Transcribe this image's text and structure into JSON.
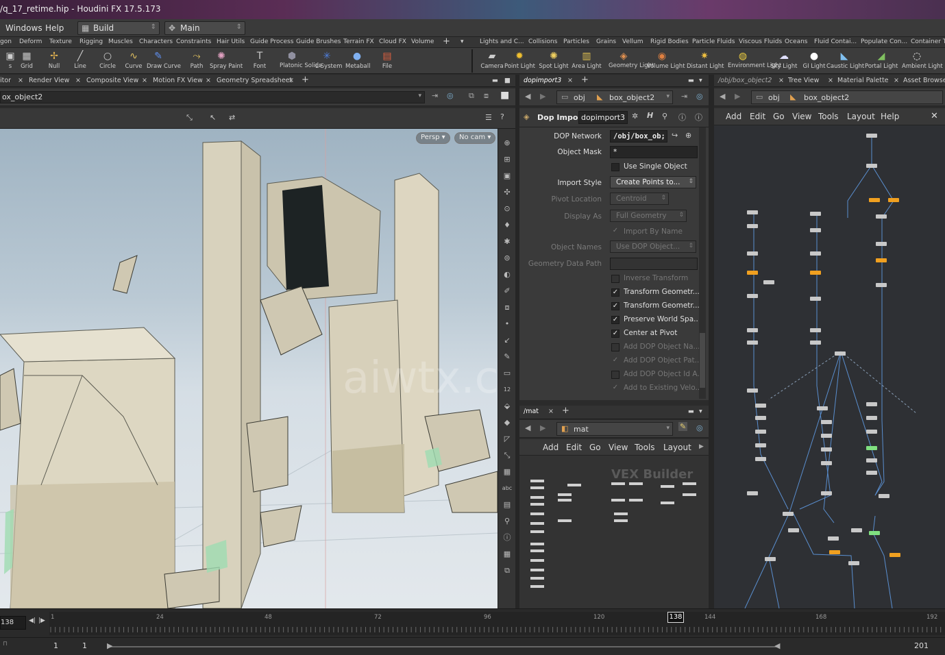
{
  "window": {
    "title": "/q_17_retime.hip - Houdini FX 17.5.173"
  },
  "menubar": {
    "windows": "Windows",
    "help": "Help",
    "desktop": "Build",
    "desktop_icon": "grid-icon",
    "shelfset": "Main"
  },
  "shelf_tabs_left": [
    "gon",
    "Deform",
    "Texture",
    "Rigging",
    "Muscles",
    "Characters",
    "Constraints",
    "Hair Utils",
    "Guide Process",
    "Guide Brushes",
    "Terrain FX",
    "Cloud FX",
    "Volume"
  ],
  "shelf_tabs_right": [
    "Lights and C...",
    "Collisions",
    "Particles",
    "Grains",
    "Vellum",
    "Rigid Bodies",
    "Particle Fluids",
    "Viscous Fluids",
    "Oceans",
    "Fluid Contai...",
    "Populate Con...",
    "Container To"
  ],
  "tools_left": [
    {
      "label": "s",
      "icon": "box-icon"
    },
    {
      "label": "Grid",
      "icon": "grid-icon"
    },
    {
      "label": "Null",
      "icon": "null-icon"
    },
    {
      "label": "Line",
      "icon": "line-icon"
    },
    {
      "label": "Circle",
      "icon": "circle-icon"
    },
    {
      "label": "Curve",
      "icon": "curve-icon"
    },
    {
      "label": "Draw Curve",
      "icon": "pen-icon"
    },
    {
      "label": "Path",
      "icon": "path-icon"
    },
    {
      "label": "Spray Paint",
      "icon": "spray-icon"
    },
    {
      "label": "Font",
      "icon": "font-icon"
    },
    {
      "label": "Platonic Solids",
      "icon": "platonic-icon"
    },
    {
      "label": "L-System",
      "icon": "lsystem-icon"
    },
    {
      "label": "Metaball",
      "icon": "metaball-icon"
    },
    {
      "label": "File",
      "icon": "file-icon"
    }
  ],
  "tools_right": [
    {
      "label": "Camera",
      "icon": "camera-icon"
    },
    {
      "label": "Point Light",
      "icon": "point-light-icon"
    },
    {
      "label": "Spot Light",
      "icon": "spot-light-icon"
    },
    {
      "label": "Area Light",
      "icon": "area-light-icon"
    },
    {
      "label": "Geometry Light",
      "icon": "geometry-light-icon"
    },
    {
      "label": "Volume Light",
      "icon": "volume-light-icon"
    },
    {
      "label": "Distant Light",
      "icon": "distant-light-icon"
    },
    {
      "label": "Environment Light",
      "icon": "environment-light-icon"
    },
    {
      "label": "Sky Light",
      "icon": "sky-light-icon"
    },
    {
      "label": "GI Light",
      "icon": "gi-light-icon"
    },
    {
      "label": "Caustic Light",
      "icon": "caustic-light-icon"
    },
    {
      "label": "Portal Light",
      "icon": "portal-light-icon"
    },
    {
      "label": "Ambient Light",
      "icon": "ambient-light-icon"
    }
  ],
  "viewer_tabs": [
    "itor",
    "Render View",
    "Composite View",
    "Motion FX View",
    "Geometry Spreadsheet"
  ],
  "viewer_path": "ox_object2",
  "viewport": {
    "persp": "Persp",
    "cam": "No cam",
    "watermark": "aiwtx.com"
  },
  "param_tabs": [
    "dopimport3"
  ],
  "param_path": {
    "root": "obj",
    "node": "box_object2"
  },
  "node": {
    "type": "Dop Import",
    "name": "dopimport3"
  },
  "params": {
    "dop_network": {
      "label": "DOP Network",
      "value": "/obj/box_ob;"
    },
    "object_mask": {
      "label": "Object Mask",
      "value": "*"
    },
    "use_single": "Use Single Object",
    "import_style": {
      "label": "Import Style",
      "value": "Create Points to..."
    },
    "pivot_location": {
      "label": "Pivot Location",
      "value": "Centroid"
    },
    "display_as": {
      "label": "Display As",
      "value": "Full Geometry"
    },
    "import_by_name": "Import By Name",
    "object_names": {
      "label": "Object Names",
      "value": "Use DOP Object..."
    },
    "geo_data_path": {
      "label": "Geometry Data Path",
      "value": ""
    },
    "inverse": "Inverse Transform",
    "xform1": "Transform Geometr...",
    "xform2": "Transform Geometr...",
    "preserve": "Preserve World Spa...",
    "center": "Center at Pivot",
    "add_name": "Add DOP Object Na...",
    "add_path": "Add DOP Object Pat...",
    "add_id": "Add DOP Object Id A...",
    "add_vel": "Add to Existing Velo..."
  },
  "mat_tabs": [
    "/mat"
  ],
  "mat_path": "mat",
  "mat_menu": [
    "Add",
    "Edit",
    "Go",
    "View",
    "Tools",
    "Layout"
  ],
  "mat_watermark": "VEX Builder",
  "net_tabs": [
    "/obj/box_object2",
    "Tree View",
    "Material Palette",
    "Asset Browser"
  ],
  "net_path": {
    "root": "obj",
    "node": "box_object2"
  },
  "net_menu": [
    "Add",
    "Edit",
    "Go",
    "View",
    "Tools",
    "Layout",
    "Help"
  ],
  "timeline": {
    "frame": "138",
    "ticks": [
      "1",
      "24",
      "48",
      "72",
      "96",
      "120",
      "144",
      "168",
      "192"
    ],
    "marker": "138"
  },
  "range": {
    "start": "1",
    "start2": "1",
    "end": "201"
  }
}
